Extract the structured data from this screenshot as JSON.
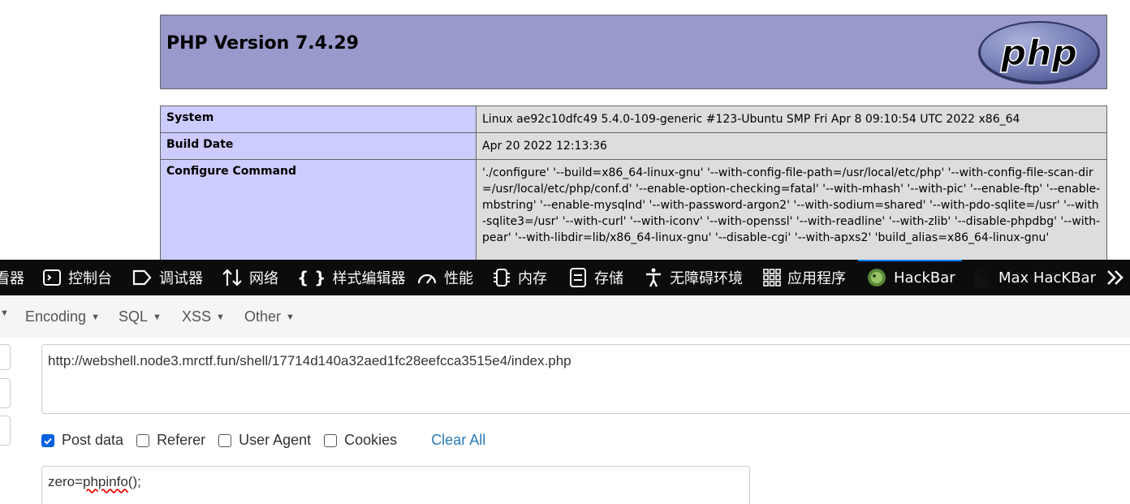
{
  "php": {
    "title": "PHP Version 7.4.29",
    "logo_text": "php",
    "rows": [
      {
        "key": "System",
        "value": "Linux ae92c10dfc49 5.4.0-109-generic #123-Ubuntu SMP Fri Apr 8 09:10:54 UTC 2022 x86_64"
      },
      {
        "key": "Build Date",
        "value": "Apr 20 2022 12:13:36"
      },
      {
        "key": "Configure Command",
        "value": "'./configure' '--build=x86_64-linux-gnu' '--with-config-file-path=/usr/local/etc/php' '--with-config-file-scan-dir=/usr/local/etc/php/conf.d' '--enable-option-checking=fatal' '--with-mhash' '--with-pic' '--enable-ftp' '--enable-mbstring' '--enable-mysqlnd' '--with-password-argon2' '--with-sodium=shared' '--with-pdo-sqlite=/usr' '--with-sqlite3=/usr' '--with-curl' '--with-iconv' '--with-openssl' '--with-readline' '--with-zlib' '--disable-phpdbg' '--with-pear' '--with-libdir=lib/x86_64-linux-gnu' '--disable-cgi' '--with-apxs2' 'build_alias=x86_64-linux-gnu'"
      }
    ]
  },
  "devtools": {
    "tabs": [
      {
        "label": "看器",
        "icon": "inspector-icon"
      },
      {
        "label": "控制台",
        "icon": "console-icon"
      },
      {
        "label": "调试器",
        "icon": "debugger-icon"
      },
      {
        "label": "网络",
        "icon": "network-icon"
      },
      {
        "label": "样式编辑器",
        "icon": "style-editor-icon"
      },
      {
        "label": "性能",
        "icon": "performance-icon"
      },
      {
        "label": "内存",
        "icon": "memory-icon"
      },
      {
        "label": "存储",
        "icon": "storage-icon"
      },
      {
        "label": "无障碍环境",
        "icon": "accessibility-icon"
      },
      {
        "label": "应用程序",
        "icon": "application-icon"
      },
      {
        "label": "HackBar",
        "icon": "hackbar-icon",
        "active": true
      },
      {
        "label": "Max HacKBar",
        "icon": "max-hackbar-icon"
      }
    ],
    "overflow_icon": "chevron-double-right-icon",
    "active_color": "#0a84ff"
  },
  "hackbar": {
    "menus": [
      "Encoding",
      "SQL",
      "XSS",
      "Other"
    ],
    "url": "http://webshell.node3.mrctf.fun/shell/17714d140a32aed1fc28eefcca3515e4/index.php",
    "options": [
      {
        "label": "Post data",
        "checked": true
      },
      {
        "label": "Referer",
        "checked": false
      },
      {
        "label": "User Agent",
        "checked": false
      },
      {
        "label": "Cookies",
        "checked": false
      }
    ],
    "clear_all": "Clear All",
    "post_data": {
      "prefix": "zero=",
      "fn": "phpinfo",
      "suffix": "();"
    }
  },
  "colors": {
    "php_header": "#9999cc",
    "table_key": "#ccccff",
    "table_value": "#dddddd",
    "devtools_bg": "#0c0c0d",
    "link": "#2a7ab8",
    "checkbox": "#0060df"
  }
}
